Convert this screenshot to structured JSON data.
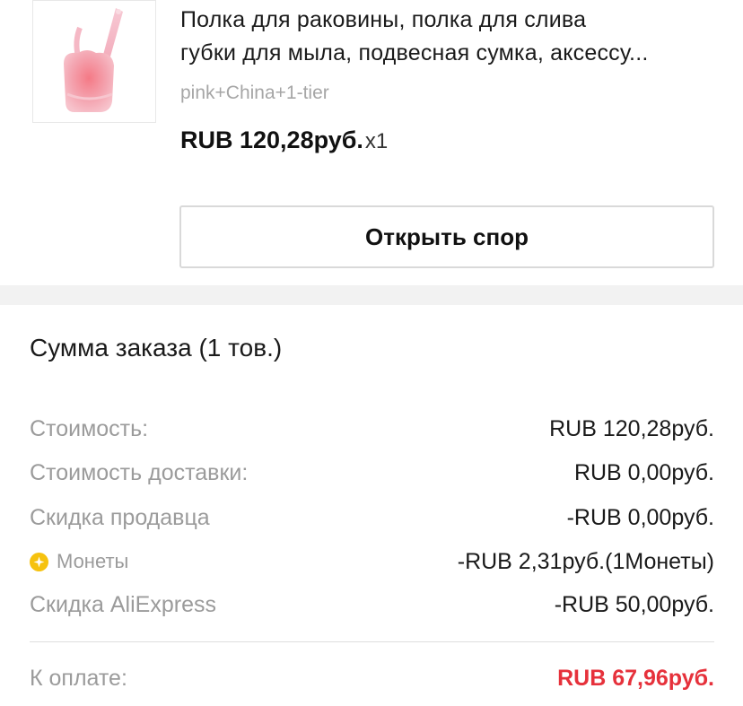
{
  "product": {
    "title_line1": "Полка для раковины, полка для слива",
    "title_line2": "губки для мыла, подвесная сумка, аксессу...",
    "variant": "pink+China+1-tier",
    "price": "RUB 120,28руб.",
    "quantity": "x1",
    "image_icon": "pink-hanging-soap-basket-image"
  },
  "actions": {
    "open_dispute": "Открыть спор"
  },
  "summary": {
    "title": "Сумма заказа (1 тов.)",
    "rows": [
      {
        "label": "Стоимость:",
        "value": "RUB 120,28руб."
      },
      {
        "label": "Стоимость доставки:",
        "value": "RUB 0,00руб."
      },
      {
        "label": "Скидка продавца",
        "value": "-RUB 0,00руб."
      },
      {
        "label": "Монеты",
        "value": "-RUB 2,31руб.(1Монеты)",
        "icon": "coin-icon"
      },
      {
        "label": "Скидка AliExpress",
        "value": "-RUB 50,00руб."
      }
    ],
    "total_label": "К оплате:",
    "total_value": "RUB 67,96руб."
  },
  "colors": {
    "accent_total": "#e6313b",
    "coin": "#f6c20f",
    "muted": "#9b9b9b"
  }
}
